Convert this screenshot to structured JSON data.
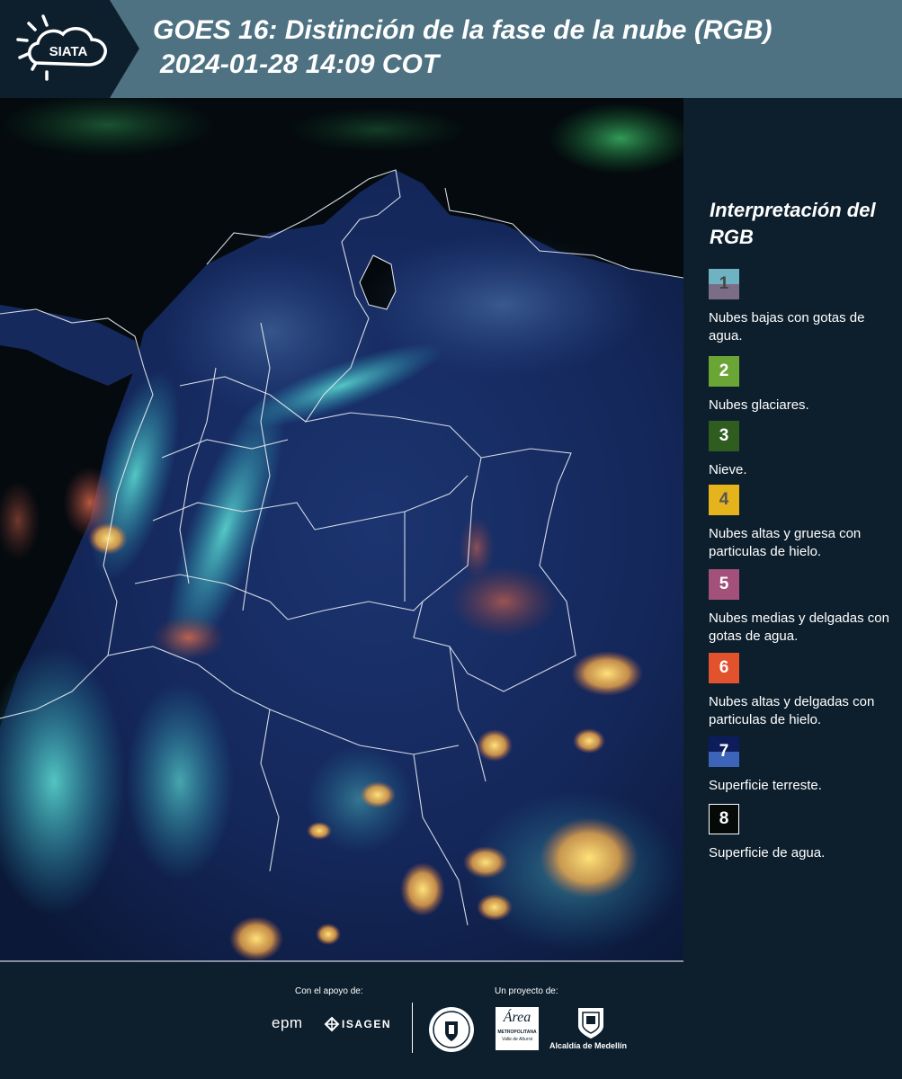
{
  "header": {
    "logo_text": "SIATA",
    "title_line1": "GOES 16: Distinción de la fase de la nube (RGB)",
    "title_line2": "2024-01-28 14:09 COT",
    "background_color": "#4e7282"
  },
  "legend": {
    "title": "Interpretación del RGB",
    "items": [
      {
        "number": "1",
        "description": "Nubes bajas con gotas de agua.",
        "color_top": "#6fb2c2",
        "color_bottom": "#7b6d86",
        "num_color": "#444444"
      },
      {
        "number": "2",
        "description": "Nubes glaciares.",
        "color_top": "#6aa535",
        "color_bottom": "#6aa535",
        "num_color": "#ffffff"
      },
      {
        "number": "3",
        "description": "Nieve.",
        "color_top": "#2f5d1f",
        "color_bottom": "#2f5d1f",
        "num_color": "#ffffff"
      },
      {
        "number": "4",
        "description": "Nubes altas y gruesa con particulas de hielo.",
        "color_top": "#e5b31c",
        "color_bottom": "#e5b31c",
        "num_color": "#555555"
      },
      {
        "number": "5",
        "description": "Nubes medias y delgadas con gotas de agua.",
        "color_top": "#a3507a",
        "color_bottom": "#a3507a",
        "num_color": "#ffffff"
      },
      {
        "number": "6",
        "description": "Nubes altas y delgadas con particulas de hielo.",
        "color_top": "#e2522c",
        "color_bottom": "#e2522c",
        "num_color": "#ffffff"
      },
      {
        "number": "7",
        "description": "Superficie terreste.",
        "color_top": "#0d1d5c",
        "color_bottom": "#3c64b8",
        "num_color": "#ffffff"
      },
      {
        "number": "8",
        "description": "Superficie de agua.",
        "color_top": "#050a08",
        "color_bottom": "#050a08",
        "num_color": "#ffffff"
      }
    ]
  },
  "footer": {
    "support_label": "Con el apoyo de:",
    "project_label": "Un proyecto de:",
    "sponsor_epm": "epm",
    "sponsor_isagen": "ISAGEN",
    "area_text": "Área",
    "area_subtitle": "METROPOLITANA",
    "area_subtitle2": "Valle de Aburrá",
    "alcaldia": "Alcaldía de Medellín"
  }
}
